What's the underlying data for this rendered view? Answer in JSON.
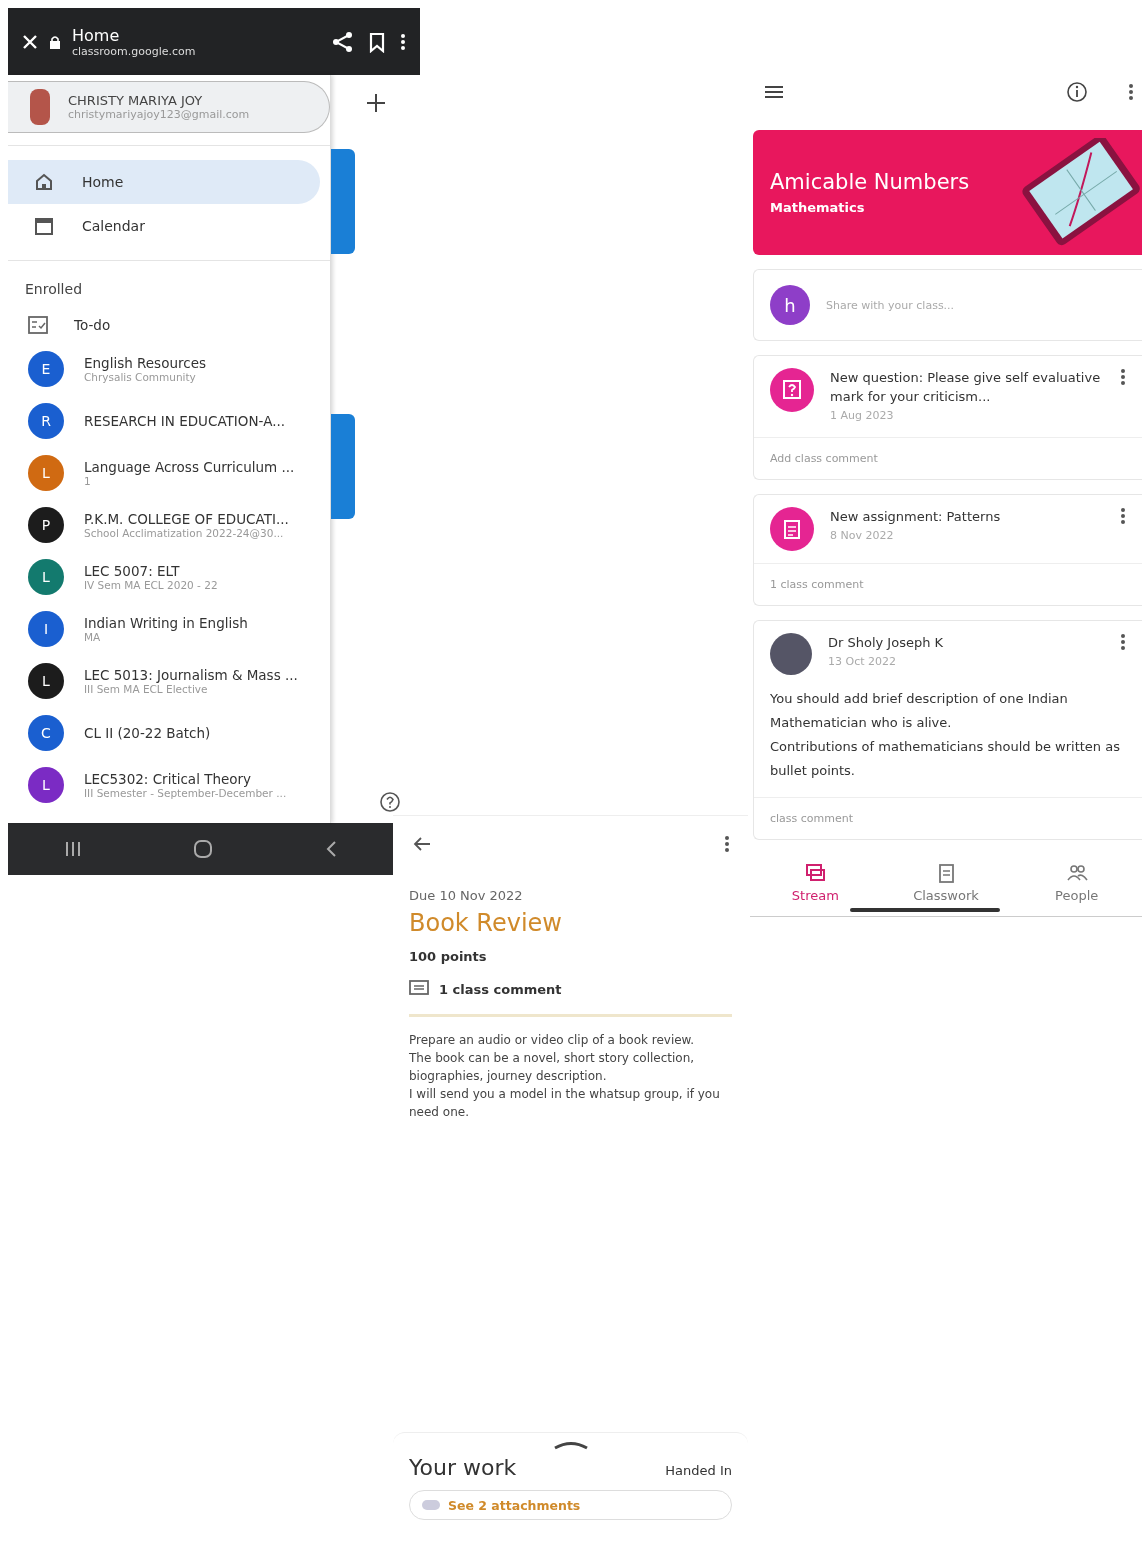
{
  "drawer_screen": {
    "browser_bar": {
      "title": "Home",
      "url": "classroom.google.com"
    },
    "account": {
      "name": "CHRISTY MARIYA JOY",
      "email": "christymariyajoy123@gmail.com"
    },
    "nav_items": [
      {
        "label": "Home",
        "selected": true
      },
      {
        "label": "Calendar",
        "selected": false
      }
    ],
    "section_heading": "Enrolled",
    "todo": "To-do",
    "classes": [
      {
        "initial": "E",
        "name": "English Resources",
        "subtitle": "Chrysalis Community",
        "color": "#1a5fd0"
      },
      {
        "initial": "R",
        "name": "RESEARCH IN EDUCATION-A...",
        "color": "#1a5fd0"
      },
      {
        "initial": "L",
        "name": "Language Across Curriculum ...",
        "subtitle": "1",
        "color": "#d06a12"
      },
      {
        "initial": "P",
        "name": "P.K.M. COLLEGE OF EDUCATI...",
        "subtitle": "School Acclimatization 2022-24@30...",
        "color": "#1c1c1c"
      },
      {
        "initial": "L",
        "name": "LEC 5007: ELT",
        "subtitle": "IV Sem MA ECL 2020 - 22",
        "color": "#137a6e"
      },
      {
        "initial": "I",
        "name": "Indian Writing in English",
        "subtitle": "MA",
        "color": "#1a5fd0"
      },
      {
        "initial": "L",
        "name": "LEC 5013: Journalism & Mass ...",
        "subtitle": "III Sem MA ECL Elective",
        "color": "#1c1c1c"
      },
      {
        "initial": "C",
        "name": "CL II (20-22 Batch)",
        "color": "#1a5fd0"
      },
      {
        "initial": "L",
        "name": "LEC5302: Critical Theory",
        "subtitle": "III Semester - September-December ...",
        "color": "#7b2bc4"
      }
    ]
  },
  "stream_screen": {
    "class_title": "Amicable Numbers",
    "class_subject": "Mathematics",
    "share": {
      "initial": "h",
      "placeholder": "Share with your class..."
    },
    "posts": [
      {
        "kind": "question",
        "title": "New question: Please give self evaluative mark for your criticism...",
        "date": "1 Aug 2023",
        "footer": "Add class comment"
      },
      {
        "kind": "assignment",
        "title": "New assignment: Patterns",
        "date": "8 Nov 2022",
        "footer": "1 class comment"
      },
      {
        "kind": "announcement",
        "title": "Dr Sholy Joseph K",
        "date": "13 Oct 2022",
        "body": "You should add brief description of one Indian Mathematician who is alive.\nContributions of mathematicians should be written as bullet points.",
        "footer": "class comment"
      }
    ],
    "tabs": [
      {
        "label": "Stream",
        "selected": true
      },
      {
        "label": "Classwork",
        "selected": false
      },
      {
        "label": "People",
        "selected": false
      }
    ]
  },
  "assignment_screen": {
    "due": "Due 10 Nov 2022",
    "title": "Book Review",
    "points": "100 points",
    "comments": "1 class comment",
    "description": "Prepare an audio or video clip of a book review.\nThe book can be a novel, short story collection, biographies, journey description.\nI will send you a model in the whatsup group, if you need one.",
    "your_work": {
      "heading": "Your work",
      "status": "Handed In",
      "attachments": "See 2 attachments"
    }
  }
}
